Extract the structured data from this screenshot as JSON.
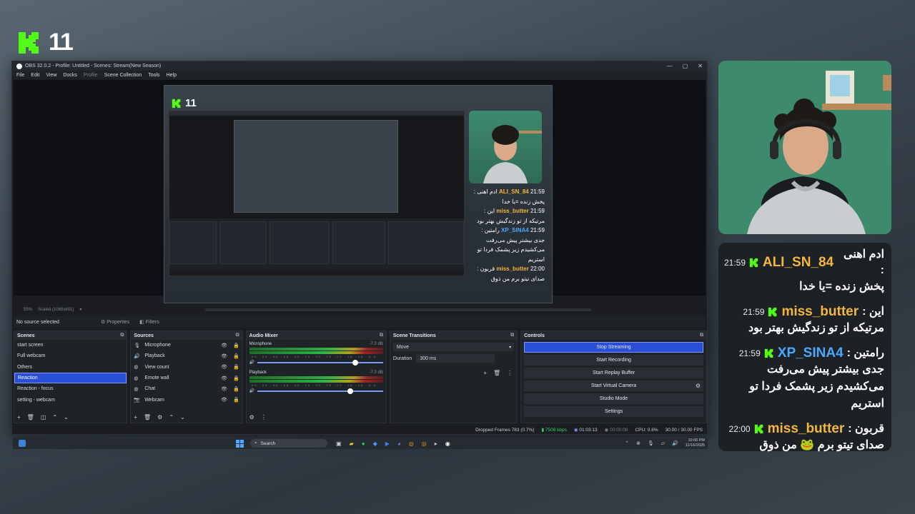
{
  "logo": {
    "text": "11",
    "color": "#53fc18"
  },
  "obs": {
    "title": "OBS 32.0.2 - Profile: Untitled - Scenes: Stream(New Season)",
    "window_buttons": [
      "—",
      "▢",
      "✕"
    ],
    "menu": [
      "File",
      "Edit",
      "View",
      "Docks",
      "Profile",
      "Scene Collection",
      "Tools",
      "Help"
    ],
    "preview": {
      "zoom": "55%",
      "scale": "Scaled (1069x601)",
      "inner_logo": "11",
      "inner_chat": [
        {
          "time": "21:59",
          "prefix": "ادم اهنی :",
          "name": "ALI_SN_84",
          "color": "#f3b73b",
          "text": "پخش زنده =یا خدا"
        },
        {
          "time": "21:59",
          "prefix": "این :",
          "name": "miss_butter",
          "color": "#f3b73b",
          "text": "مرتیکه از تو زندگیش بهتر بود"
        },
        {
          "time": "21:59",
          "prefix": "رامتین :",
          "name": "XP_SINA4",
          "color": "#4aa8ff",
          "text": "جدی بیشتر پیش می‌رفت می‌کشیدم زیر پشمک فردا تو استریم"
        },
        {
          "time": "22:00",
          "prefix": "قربون :",
          "name": "miss_butter",
          "color": "#f3b73b",
          "text": "صدای تیتو برم من ذوق"
        }
      ]
    },
    "context_bar": {
      "no_source": "No source selected",
      "properties": "Properties",
      "filters": "Filters"
    },
    "scenes": {
      "title": "Scenes",
      "items": [
        "start screen",
        "Full webcam",
        "Others",
        "Reaction",
        "Reaction - focus",
        "setting - webcam"
      ],
      "selected_index": 3
    },
    "sources": {
      "title": "Sources",
      "items": [
        {
          "label": "Microphone",
          "icon": "microphone-icon"
        },
        {
          "label": "Playback",
          "icon": "speaker-icon"
        },
        {
          "label": "View count",
          "icon": "globe-icon"
        },
        {
          "label": "Emote wall",
          "icon": "globe-icon"
        },
        {
          "label": "Chat",
          "icon": "globe-icon"
        },
        {
          "label": "Webcam",
          "icon": "camera-icon"
        }
      ]
    },
    "mixer": {
      "title": "Audio Mixer",
      "tracks": [
        {
          "name": "Microphone",
          "db": "-7.0 dB",
          "level": 0.78
        },
        {
          "name": "Playback",
          "db": "-7.0 dB",
          "level": 0.74
        }
      ]
    },
    "transitions": {
      "title": "Scene Transitions",
      "selected": "Move",
      "duration_label": "Duration",
      "duration": "300 ms"
    },
    "controls": {
      "title": "Controls",
      "buttons": [
        "Stop Streaming",
        "Start Recording",
        "Start Replay Buffer",
        "Start Virtual Camera",
        "Studio Mode",
        "Settings"
      ]
    },
    "status": {
      "dropped": "Dropped Frames 783 (0.7%)",
      "bitrate": "7508 kbps",
      "stream_time": "01:03:13",
      "rec_time": "00:00:00",
      "cpu": "CPU: 0.6%",
      "fps": "30.00 / 30.00 FPS"
    }
  },
  "taskbar": {
    "search": "Search",
    "time": "10:00 PM",
    "date": "11/16/2025"
  },
  "chat": {
    "messages": [
      {
        "time": "21:59",
        "prefix": "ادم اهنی :",
        "name": "ALI_SN_84",
        "color": "#f3b73b",
        "text": "پخش زنده =یا خدا"
      },
      {
        "time": "21:59",
        "prefix": "این :",
        "name": "miss_butter",
        "color": "#f3b73b",
        "text": "مرتیکه از تو زندگیش بهتر بود"
      },
      {
        "time": "21:59",
        "prefix": "رامتین :",
        "name": "XP_SINA4",
        "color": "#4aa8ff",
        "text": "جدی بیشتر پیش می‌رفت می‌کشیدم زیر پشمک فردا تو استریم"
      },
      {
        "time": "22:00",
        "prefix": "قربون :",
        "name": "miss_butter",
        "color": "#f3b73b",
        "text": "صدای تیتو برم 🐸 من ذوق"
      }
    ]
  }
}
